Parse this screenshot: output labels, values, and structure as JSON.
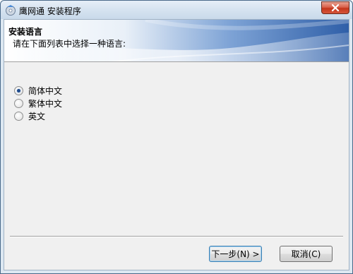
{
  "window": {
    "title": "鹰网通 安装程序"
  },
  "header": {
    "title": "安装语言",
    "subtitle": "请在下面列表中选择一种语言:"
  },
  "languages": [
    {
      "label": "简体中文",
      "selected": true
    },
    {
      "label": "繁体中文",
      "selected": false
    },
    {
      "label": "英文",
      "selected": false
    }
  ],
  "buttons": {
    "next": "下一步(N) >",
    "cancel": "取消(C)"
  },
  "icons": {
    "app": "installer-disc-icon",
    "close": "close-icon"
  },
  "colors": {
    "banner_blue": "#3c6fb5",
    "close_red": "#c5361c",
    "window_frame": "#dde8f2"
  }
}
